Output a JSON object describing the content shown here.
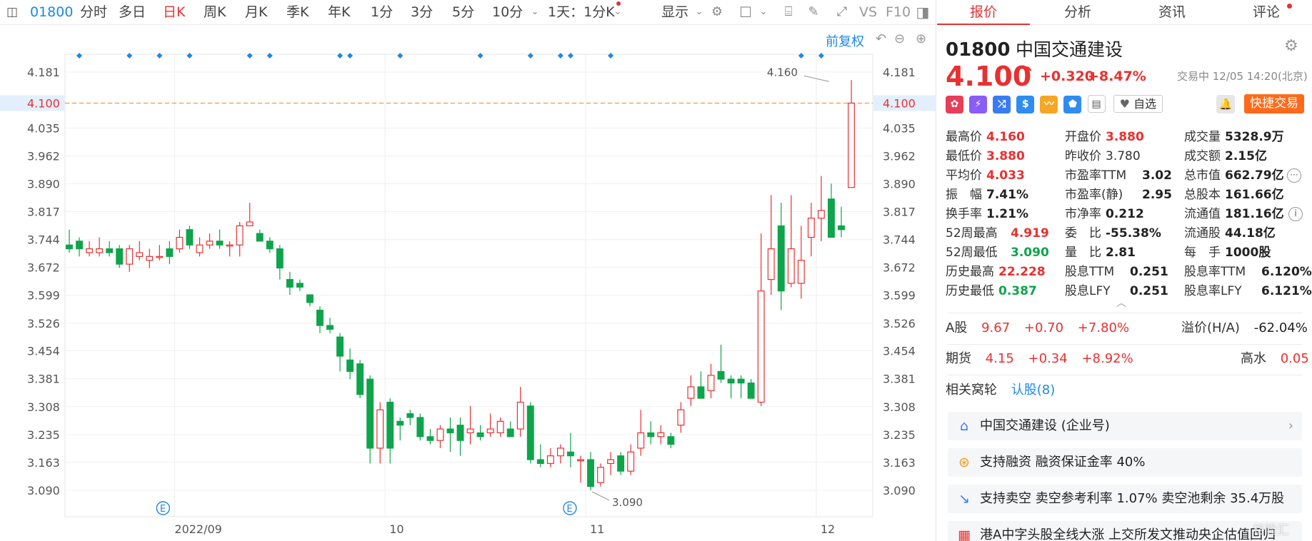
{
  "toolbar": {
    "code": "01800",
    "periods": [
      "分时",
      "多日",
      "日K",
      "周K",
      "月K",
      "季K",
      "年K",
      "1分",
      "3分",
      "5分",
      "10分"
    ],
    "active_period": "日K",
    "period_dropdown": "1天：1分K",
    "display": "显示",
    "vs_label": "VS",
    "f10_label": "F10"
  },
  "chart": {
    "restore_label": "前复权",
    "marker_label": "E",
    "high_annotation": "4.160",
    "low_annotation": "3.090",
    "colors": {
      "up": "#e93030",
      "down": "#0ea44b",
      "dash": "#f39c3c",
      "diamond": "#1e88e5"
    }
  },
  "chart_data": {
    "type": "candlestick",
    "title": "",
    "x_labels": [
      {
        "label": "2022/09",
        "index": 11
      },
      {
        "label": "10",
        "index": 32
      },
      {
        "label": "11",
        "index": 52
      },
      {
        "label": "12",
        "index": 75
      }
    ],
    "y_ticks": [
      "4.181",
      "4.100",
      "4.035",
      "3.962",
      "3.890",
      "3.817",
      "3.744",
      "3.672",
      "3.599",
      "3.526",
      "3.454",
      "3.381",
      "3.308",
      "3.235",
      "3.163",
      "3.090"
    ],
    "ylim": [
      3.05,
      4.22
    ],
    "last_price": 4.1,
    "high_point": {
      "index": 76,
      "value": 4.16
    },
    "low_point": {
      "index": 52,
      "value": 3.09
    },
    "event_markers": [
      9,
      50
    ],
    "diamond_markers": [
      1,
      6,
      9,
      12,
      18,
      20,
      27,
      28,
      33,
      41,
      46,
      49,
      50,
      54,
      73,
      75
    ],
    "candles": [
      {
        "o": 3.73,
        "h": 3.77,
        "l": 3.71,
        "c": 3.72
      },
      {
        "o": 3.74,
        "h": 3.75,
        "l": 3.7,
        "c": 3.72
      },
      {
        "o": 3.71,
        "h": 3.74,
        "l": 3.7,
        "c": 3.72
      },
      {
        "o": 3.71,
        "h": 3.75,
        "l": 3.7,
        "c": 3.72
      },
      {
        "o": 3.72,
        "h": 3.74,
        "l": 3.7,
        "c": 3.71
      },
      {
        "o": 3.72,
        "h": 3.73,
        "l": 3.67,
        "c": 3.68
      },
      {
        "o": 3.68,
        "h": 3.73,
        "l": 3.66,
        "c": 3.72
      },
      {
        "o": 3.7,
        "h": 3.74,
        "l": 3.69,
        "c": 3.71
      },
      {
        "o": 3.69,
        "h": 3.72,
        "l": 3.67,
        "c": 3.7
      },
      {
        "o": 3.7,
        "h": 3.73,
        "l": 3.69,
        "c": 3.7
      },
      {
        "o": 3.72,
        "h": 3.74,
        "l": 3.68,
        "c": 3.7
      },
      {
        "o": 3.72,
        "h": 3.77,
        "l": 3.71,
        "c": 3.75
      },
      {
        "o": 3.77,
        "h": 3.78,
        "l": 3.72,
        "c": 3.73
      },
      {
        "o": 3.71,
        "h": 3.75,
        "l": 3.7,
        "c": 3.73
      },
      {
        "o": 3.73,
        "h": 3.76,
        "l": 3.72,
        "c": 3.74
      },
      {
        "o": 3.74,
        "h": 3.77,
        "l": 3.72,
        "c": 3.73
      },
      {
        "o": 3.73,
        "h": 3.74,
        "l": 3.7,
        "c": 3.73
      },
      {
        "o": 3.73,
        "h": 3.79,
        "l": 3.7,
        "c": 3.78
      },
      {
        "o": 3.78,
        "h": 3.84,
        "l": 3.78,
        "c": 3.79
      },
      {
        "o": 3.76,
        "h": 3.77,
        "l": 3.74,
        "c": 3.74
      },
      {
        "o": 3.74,
        "h": 3.75,
        "l": 3.71,
        "c": 3.72
      },
      {
        "o": 3.72,
        "h": 3.73,
        "l": 3.64,
        "c": 3.67
      },
      {
        "o": 3.64,
        "h": 3.66,
        "l": 3.6,
        "c": 3.62
      },
      {
        "o": 3.63,
        "h": 3.64,
        "l": 3.61,
        "c": 3.62
      },
      {
        "o": 3.6,
        "h": 3.6,
        "l": 3.57,
        "c": 3.58
      },
      {
        "o": 3.56,
        "h": 3.57,
        "l": 3.5,
        "c": 3.52
      },
      {
        "o": 3.52,
        "h": 3.54,
        "l": 3.5,
        "c": 3.51
      },
      {
        "o": 3.49,
        "h": 3.5,
        "l": 3.4,
        "c": 3.44
      },
      {
        "o": 3.43,
        "h": 3.46,
        "l": 3.38,
        "c": 3.4
      },
      {
        "o": 3.42,
        "h": 3.43,
        "l": 3.33,
        "c": 3.34
      },
      {
        "o": 3.38,
        "h": 3.39,
        "l": 3.16,
        "c": 3.2
      },
      {
        "o": 3.2,
        "h": 3.32,
        "l": 3.16,
        "c": 3.3
      },
      {
        "o": 3.32,
        "h": 3.33,
        "l": 3.16,
        "c": 3.2
      },
      {
        "o": 3.27,
        "h": 3.28,
        "l": 3.22,
        "c": 3.26
      },
      {
        "o": 3.29,
        "h": 3.3,
        "l": 3.26,
        "c": 3.28
      },
      {
        "o": 3.28,
        "h": 3.29,
        "l": 3.22,
        "c": 3.23
      },
      {
        "o": 3.23,
        "h": 3.25,
        "l": 3.21,
        "c": 3.22
      },
      {
        "o": 3.22,
        "h": 3.26,
        "l": 3.2,
        "c": 3.25
      },
      {
        "o": 3.25,
        "h": 3.28,
        "l": 3.19,
        "c": 3.24
      },
      {
        "o": 3.26,
        "h": 3.28,
        "l": 3.18,
        "c": 3.22
      },
      {
        "o": 3.24,
        "h": 3.31,
        "l": 3.21,
        "c": 3.25
      },
      {
        "o": 3.24,
        "h": 3.26,
        "l": 3.22,
        "c": 3.23
      },
      {
        "o": 3.24,
        "h": 3.29,
        "l": 3.23,
        "c": 3.25
      },
      {
        "o": 3.24,
        "h": 3.28,
        "l": 3.23,
        "c": 3.27
      },
      {
        "o": 3.25,
        "h": 3.27,
        "l": 3.23,
        "c": 3.23
      },
      {
        "o": 3.25,
        "h": 3.36,
        "l": 3.23,
        "c": 3.32
      },
      {
        "o": 3.31,
        "h": 3.32,
        "l": 3.16,
        "c": 3.17
      },
      {
        "o": 3.17,
        "h": 3.21,
        "l": 3.15,
        "c": 3.16
      },
      {
        "o": 3.16,
        "h": 3.2,
        "l": 3.15,
        "c": 3.18
      },
      {
        "o": 3.18,
        "h": 3.21,
        "l": 3.16,
        "c": 3.2
      },
      {
        "o": 3.19,
        "h": 3.24,
        "l": 3.15,
        "c": 3.18
      },
      {
        "o": 3.17,
        "h": 3.18,
        "l": 3.11,
        "c": 3.17
      },
      {
        "o": 3.17,
        "h": 3.19,
        "l": 3.09,
        "c": 3.1
      },
      {
        "o": 3.11,
        "h": 3.16,
        "l": 3.1,
        "c": 3.15
      },
      {
        "o": 3.16,
        "h": 3.19,
        "l": 3.13,
        "c": 3.17
      },
      {
        "o": 3.18,
        "h": 3.19,
        "l": 3.13,
        "c": 3.14
      },
      {
        "o": 3.14,
        "h": 3.21,
        "l": 3.13,
        "c": 3.19
      },
      {
        "o": 3.2,
        "h": 3.3,
        "l": 3.18,
        "c": 3.24
      },
      {
        "o": 3.24,
        "h": 3.27,
        "l": 3.21,
        "c": 3.23
      },
      {
        "o": 3.23,
        "h": 3.26,
        "l": 3.21,
        "c": 3.24
      },
      {
        "o": 3.23,
        "h": 3.24,
        "l": 3.2,
        "c": 3.21
      },
      {
        "o": 3.26,
        "h": 3.32,
        "l": 3.24,
        "c": 3.3
      },
      {
        "o": 3.33,
        "h": 3.39,
        "l": 3.31,
        "c": 3.36
      },
      {
        "o": 3.36,
        "h": 3.4,
        "l": 3.33,
        "c": 3.33
      },
      {
        "o": 3.35,
        "h": 3.42,
        "l": 3.33,
        "c": 3.39
      },
      {
        "o": 3.4,
        "h": 3.47,
        "l": 3.37,
        "c": 3.38
      },
      {
        "o": 3.38,
        "h": 3.39,
        "l": 3.33,
        "c": 3.37
      },
      {
        "o": 3.38,
        "h": 3.39,
        "l": 3.33,
        "c": 3.37
      },
      {
        "o": 3.37,
        "h": 3.38,
        "l": 3.33,
        "c": 3.33
      },
      {
        "o": 3.32,
        "h": 3.76,
        "l": 3.31,
        "c": 3.61
      },
      {
        "o": 3.64,
        "h": 3.86,
        "l": 3.6,
        "c": 3.72
      },
      {
        "o": 3.78,
        "h": 3.84,
        "l": 3.56,
        "c": 3.61
      },
      {
        "o": 3.63,
        "h": 3.86,
        "l": 3.62,
        "c": 3.72
      },
      {
        "o": 3.63,
        "h": 3.78,
        "l": 3.59,
        "c": 3.69
      },
      {
        "o": 3.75,
        "h": 3.84,
        "l": 3.7,
        "c": 3.8
      },
      {
        "o": 3.8,
        "h": 3.91,
        "l": 3.74,
        "c": 3.82
      },
      {
        "o": 3.85,
        "h": 3.89,
        "l": 3.75,
        "c": 3.75
      },
      {
        "o": 3.78,
        "h": 3.83,
        "l": 3.75,
        "c": 3.77
      },
      {
        "o": 3.88,
        "h": 4.16,
        "l": 3.88,
        "c": 4.1
      }
    ]
  },
  "panel": {
    "tabs": [
      "报价",
      "分析",
      "资讯",
      "评论"
    ],
    "active_tab": "报价",
    "code": "01800",
    "name": "中国交通建设",
    "price": "4.100",
    "arrow": "↑",
    "change": "+0.320",
    "change_pct": "+8.47%",
    "status_time": "交易中 12/05 14:20(北京)",
    "watch_label": "自选",
    "trade_button": "快捷交易",
    "stats": [
      {
        "label": "最高价",
        "value": "4.160",
        "color": "red"
      },
      {
        "label": "开盘价",
        "value": "3.880",
        "color": "red"
      },
      {
        "label": "成交量",
        "value": "5328.9万",
        "color": "dark"
      },
      {
        "label": "最低价",
        "value": "3.880",
        "color": "red"
      },
      {
        "label": "昨收价",
        "value": "3.780",
        "color": "plain"
      },
      {
        "label": "成交额",
        "value": "2.15亿",
        "color": "dark"
      },
      {
        "label": "平均价",
        "value": "4.033",
        "color": "red"
      },
      {
        "label": "市盈率TTM",
        "value": "3.02",
        "color": "dark"
      },
      {
        "label": "总市值",
        "value": "662.79亿",
        "color": "dark"
      },
      {
        "label": "振　幅",
        "value": "7.41%",
        "color": "dark"
      },
      {
        "label": "市盈率(静)",
        "value": "2.95",
        "color": "dark"
      },
      {
        "label": "总股本",
        "value": "161.66亿",
        "color": "dark"
      },
      {
        "label": "换手率",
        "value": "1.21%",
        "color": "dark"
      },
      {
        "label": "市净率",
        "value": "0.212",
        "color": "dark"
      },
      {
        "label": "流通值",
        "value": "181.16亿",
        "color": "dark"
      },
      {
        "label": "52周最高",
        "value": "4.919",
        "color": "red"
      },
      {
        "label": "委　比",
        "value": "-55.38%",
        "color": "dark"
      },
      {
        "label": "流通股",
        "value": "44.18亿",
        "color": "dark"
      },
      {
        "label": "52周最低",
        "value": "3.090",
        "color": "green"
      },
      {
        "label": "量　比",
        "value": "2.81",
        "color": "dark"
      },
      {
        "label": "每　手",
        "value": "1000股",
        "color": "dark"
      },
      {
        "label": "历史最高",
        "value": "22.228",
        "color": "red"
      },
      {
        "label": "股息TTM",
        "value": "0.251",
        "color": "dark"
      },
      {
        "label": "股息率TTM",
        "value": "6.120%",
        "color": "dark"
      },
      {
        "label": "历史最低",
        "value": "0.387",
        "color": "green"
      },
      {
        "label": "股息LFY",
        "value": "0.251",
        "color": "dark"
      },
      {
        "label": "股息率LFY",
        "value": "6.121%",
        "color": "dark"
      }
    ],
    "a_share": {
      "label": "A股",
      "price": "9.67",
      "change": "+0.70",
      "pct": "+7.80%",
      "premium_label": "溢价(H/A)",
      "premium": "-62.04%"
    },
    "futures": {
      "label": "期货",
      "price": "4.15",
      "change": "+0.34",
      "pct": "+8.92%",
      "extra_label": "高水",
      "extra": "0.05"
    },
    "warrants": {
      "label": "相关窝轮",
      "link": "认股(8)"
    },
    "list": [
      "中国交通建设 (企业号)",
      "支持融资 融资保证金率 40%",
      "支持卖空 卖空参考利率 1.07% 卖空池剩余 35.4万股",
      "港A中字头股全线大涨 上交所发文推动央企估值回归"
    ],
    "watermark": "格隆汇"
  }
}
